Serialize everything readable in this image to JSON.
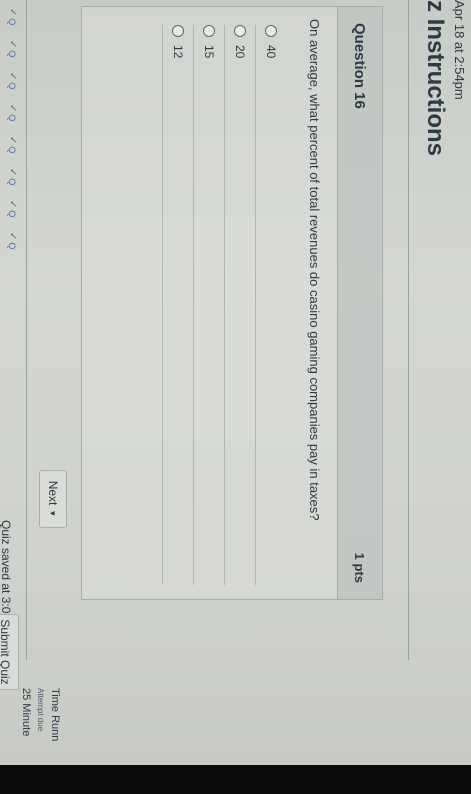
{
  "header": {
    "due_text": "Apr 18 at 2:54pm",
    "title": "z Instructions"
  },
  "question": {
    "title": "Question 16",
    "points": "1 pts",
    "text": "On average, what percent of total revenues do casino gaming companies pay in taxes?",
    "answers": [
      {
        "label": "40"
      },
      {
        "label": "20"
      },
      {
        "label": "15"
      },
      {
        "label": "12"
      }
    ]
  },
  "nav": {
    "next_label": "Next",
    "next_icon": "caret-down-icon"
  },
  "footer": {
    "quiz_saved": "Quiz saved at 3:09pm",
    "submit_label": "Submit Quiz"
  },
  "sidebar": {
    "time_running": "Time Runn",
    "attempt_due": "Attempt due",
    "minutes": "25 Minute"
  },
  "question_nav": {
    "items": [
      {
        "label": "Q",
        "icon": "checkmark-icon"
      },
      {
        "label": "Q",
        "icon": "checkmark-icon"
      },
      {
        "label": "Q",
        "icon": "checkmark-icon"
      },
      {
        "label": "Q",
        "icon": "checkmark-icon"
      },
      {
        "label": "Q",
        "icon": "checkmark-icon"
      },
      {
        "label": "Q",
        "icon": "checkmark-icon"
      },
      {
        "label": "Q",
        "icon": "checkmark-icon"
      },
      {
        "label": "Q",
        "icon": "checkmark-icon"
      }
    ]
  },
  "colors": {
    "text": "#2d3b45",
    "link": "#4a6fa5",
    "check": "#4f7e57"
  }
}
